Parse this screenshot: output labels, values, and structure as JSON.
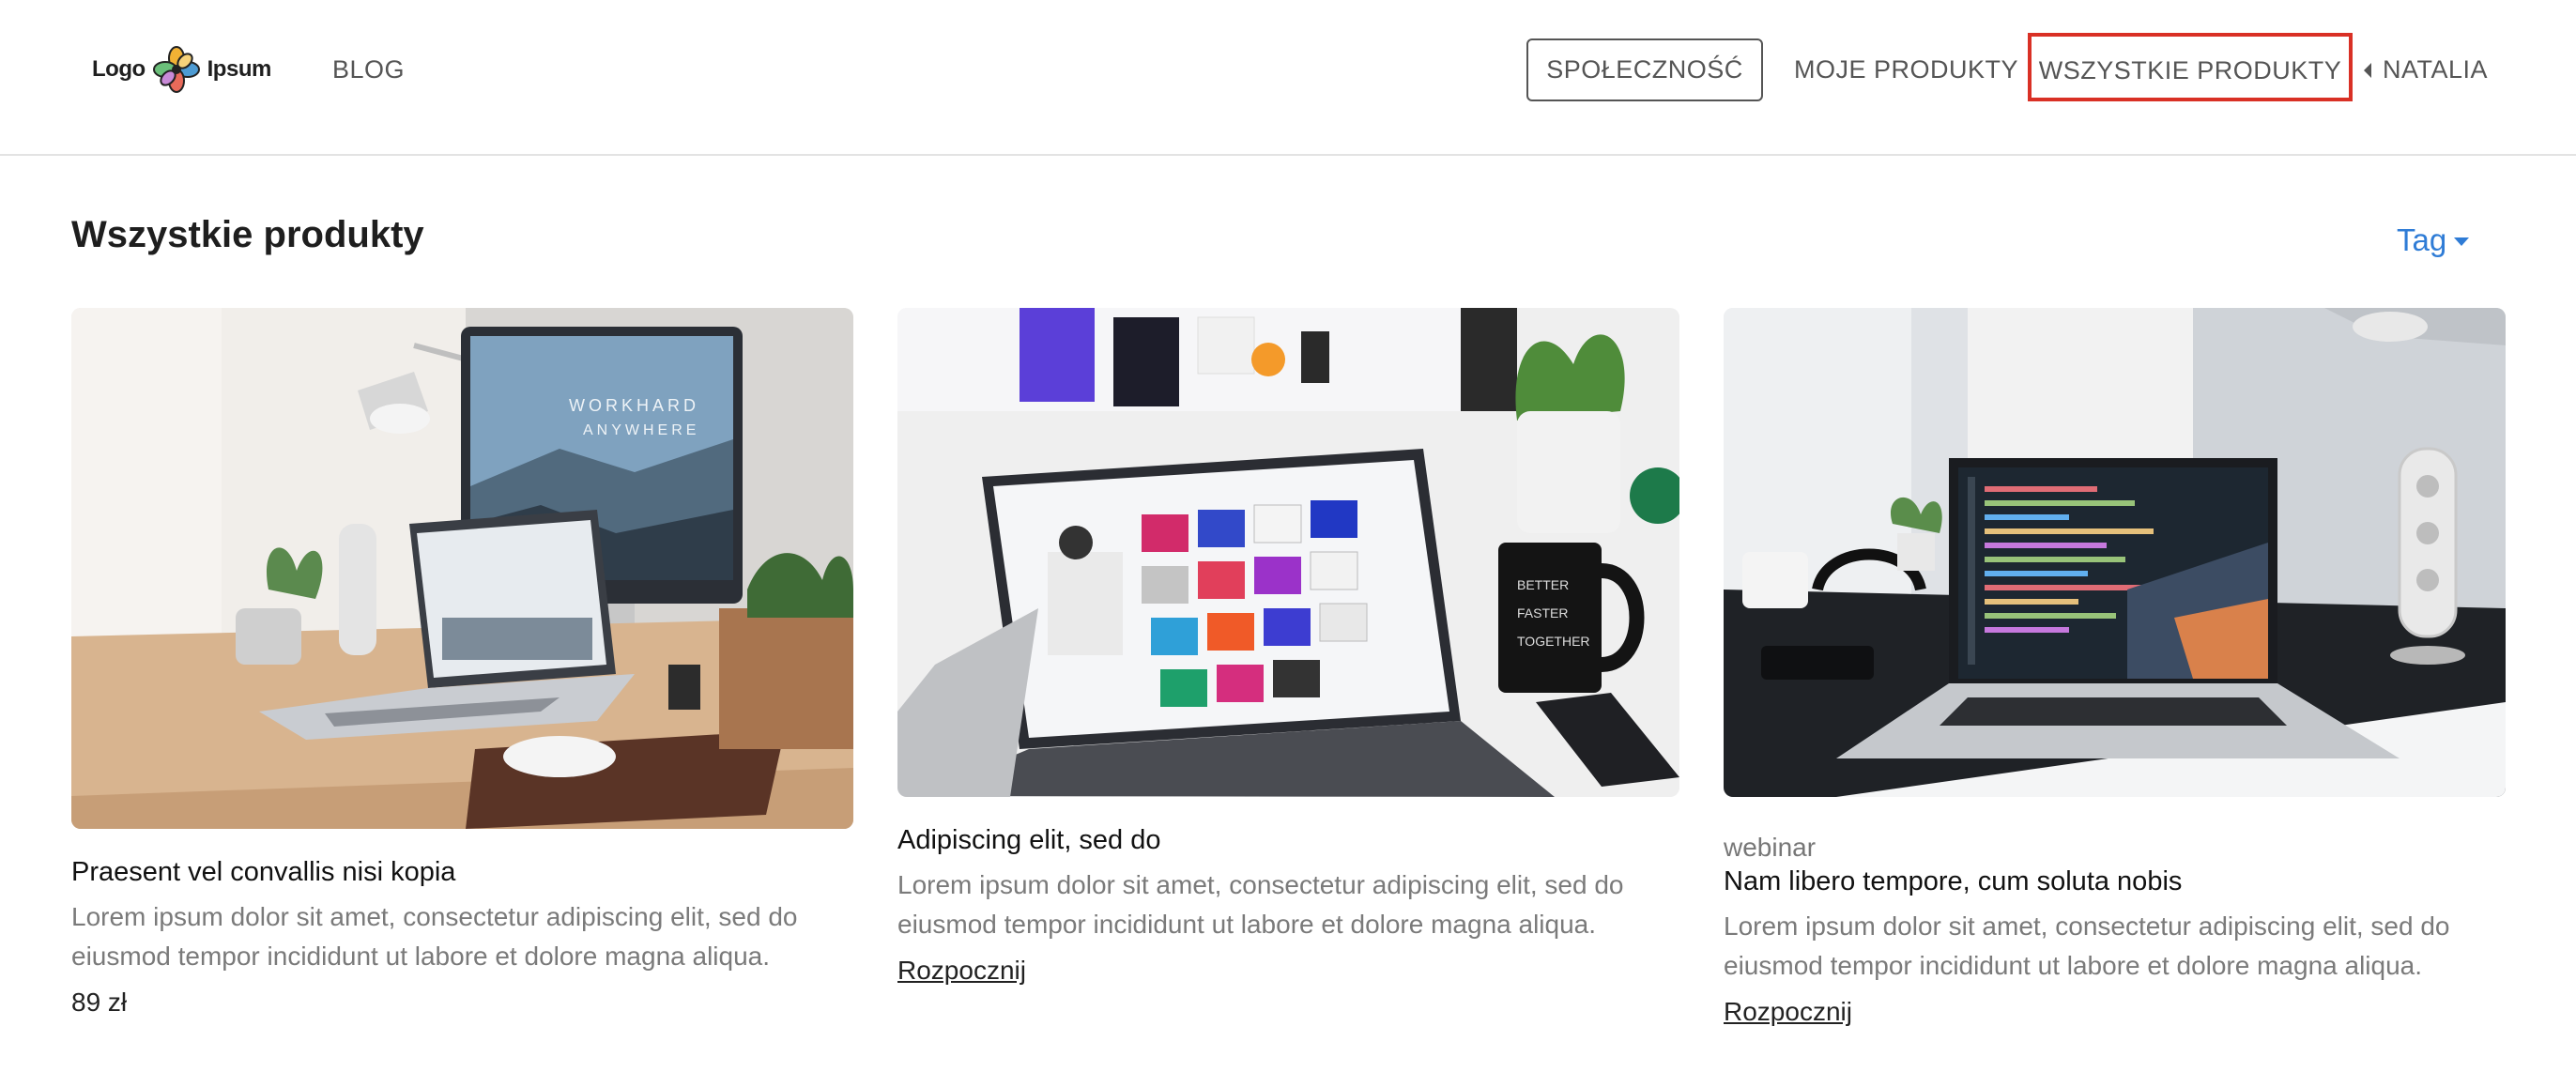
{
  "header": {
    "logo_text_left": "Logo",
    "logo_text_right": "Ipsum",
    "blog": "BLOG",
    "community": "SPOŁECZNOŚĆ",
    "my_products": "MOJE PRODUKTY",
    "all_products": "WSZYSTKIE PRODUKTY",
    "user": "NATALIA"
  },
  "page": {
    "title": "Wszystkie produkty",
    "tag_filter": "Tag"
  },
  "cards": [
    {
      "category": "",
      "title": "Praesent vel convallis nisi kopia",
      "description": "Lorem ipsum dolor sit amet, consectetur adipiscing elit, sed do eiusmod tempor incididunt ut labore et dolore magna aliqua.",
      "price": "89 zł",
      "image": "desk-imac-laptop-photo"
    },
    {
      "category": "",
      "title": "Adipiscing elit, sed do",
      "description": "Lorem ipsum dolor sit amet, consectetur adipiscing elit, sed do eiusmod tempor incididunt ut labore et dolore magna aliqua.",
      "link": "Rozpocznij",
      "image": "macbook-mug-plant-photo"
    },
    {
      "category": "webinar",
      "title": "Nam libero tempore, cum soluta nobis",
      "description": "Lorem ipsum dolor sit amet, consectetur adipiscing elit, sed do eiusmod tempor incididunt ut labore et dolore magna aliqua.",
      "link": "Rozpocznij",
      "image": "laptop-code-editor-photo"
    }
  ],
  "colors": {
    "accent_blue": "#2f7cd6",
    "highlight_red": "#d93025"
  }
}
